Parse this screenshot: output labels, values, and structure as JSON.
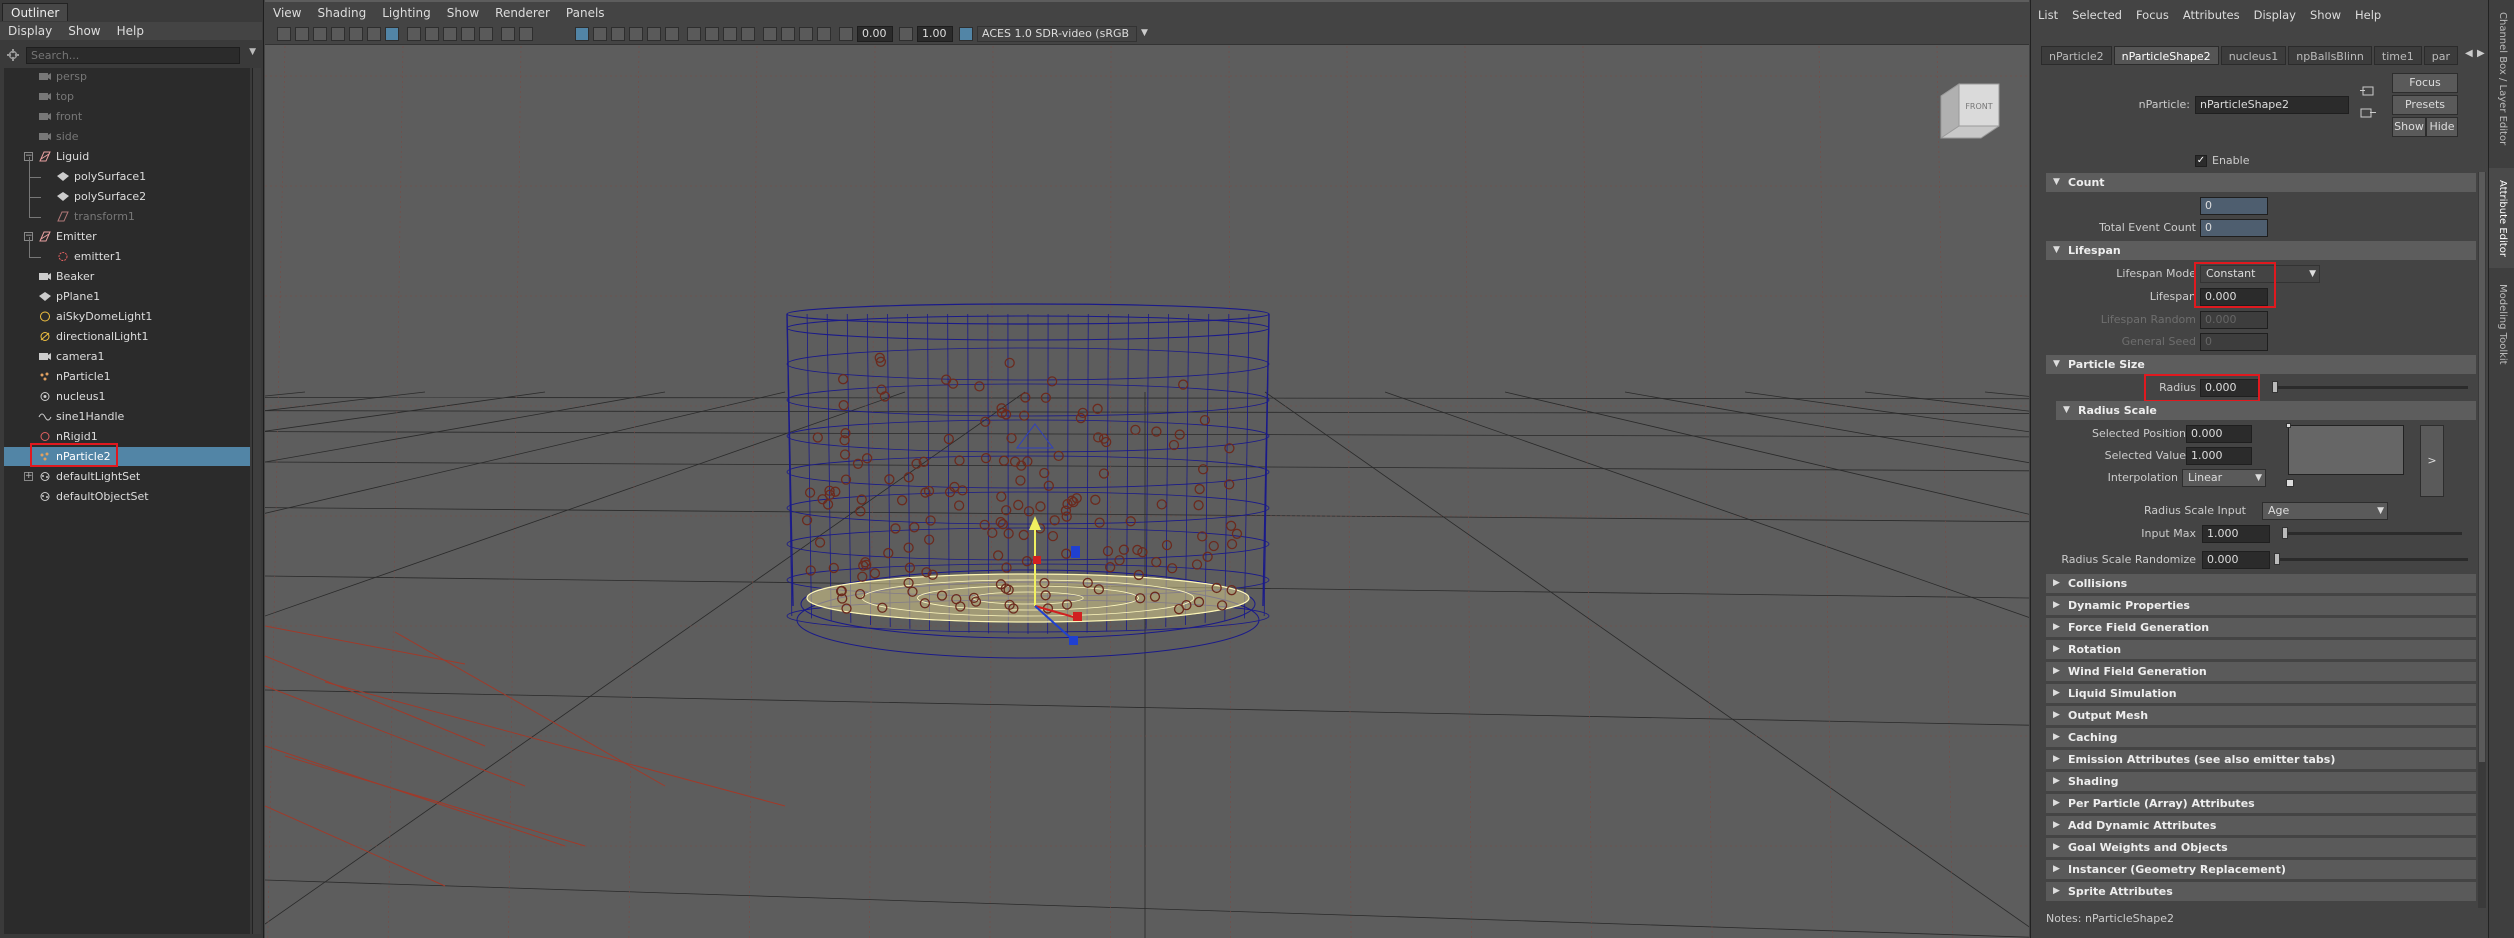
{
  "outliner": {
    "tab_label": "Outliner",
    "menu": [
      "Display",
      "Show",
      "Help"
    ],
    "search_placeholder": "Search...",
    "items": [
      {
        "label": "persp",
        "icon": "camera-icon",
        "dim": true
      },
      {
        "label": "top",
        "icon": "camera-icon",
        "dim": true
      },
      {
        "label": "front",
        "icon": "camera-icon",
        "dim": true
      },
      {
        "label": "side",
        "icon": "camera-icon",
        "dim": true
      },
      {
        "label": "Liguid",
        "icon": "group-icon"
      },
      {
        "label": "polySurface1",
        "icon": "mesh-icon"
      },
      {
        "label": "polySurface2",
        "icon": "mesh-icon"
      },
      {
        "label": "transform1",
        "icon": "transform-icon",
        "dim": true
      },
      {
        "label": "Emitter",
        "icon": "group-icon"
      },
      {
        "label": "emitter1",
        "icon": "emitter-icon"
      },
      {
        "label": "Beaker",
        "icon": "camera-icon"
      },
      {
        "label": "pPlane1",
        "icon": "mesh-icon"
      },
      {
        "label": "aiSkyDomeLight1",
        "icon": "skydome-light-icon"
      },
      {
        "label": "directionalLight1",
        "icon": "directional-light-icon"
      },
      {
        "label": "camera1",
        "icon": "camera-icon"
      },
      {
        "label": "nParticle1",
        "icon": "nparticle-icon"
      },
      {
        "label": "nucleus1",
        "icon": "nucleus-icon"
      },
      {
        "label": "sine1Handle",
        "icon": "deformer-handle-icon"
      },
      {
        "label": "nRigid1",
        "icon": "nrigid-icon"
      },
      {
        "label": "nParticle2",
        "icon": "nparticle-icon",
        "selected": true
      },
      {
        "label": "defaultLightSet",
        "icon": "set-icon"
      },
      {
        "label": "defaultObjectSet",
        "icon": "set-icon"
      }
    ]
  },
  "viewport": {
    "menu": [
      "View",
      "Shading",
      "Lighting",
      "Show",
      "Renderer",
      "Panels"
    ],
    "exposure": "0.00",
    "gamma": "1.00",
    "color_space": "ACES 1.0 SDR-video (sRGB",
    "viewcube_label": "FRONT"
  },
  "attribute_editor": {
    "menu": [
      "List",
      "Selected",
      "Focus",
      "Attributes",
      "Display",
      "Show",
      "Help"
    ],
    "tabs": [
      "nParticle2",
      "nParticleShape2",
      "nucleus1",
      "npBallsBlinn",
      "time1",
      "par"
    ],
    "active_tab": "nParticleShape2",
    "node_label": "nParticle:",
    "node_name": "nParticleShape2",
    "buttons": {
      "focus": "Focus",
      "presets": "Presets",
      "show": "Show",
      "hide": "Hide"
    },
    "enable_label": "Enable",
    "sections": {
      "count": "Count",
      "lifespan": "Lifespan",
      "particle_size": "Particle Size",
      "radius_scale": "Radius Scale"
    },
    "count": {
      "count_label": "Count",
      "count_value": "0",
      "total_label": "Total Event Count",
      "total_value": "0"
    },
    "lifespan": {
      "mode_label": "Lifespan Mode",
      "mode_value": "Constant",
      "lifespan_label": "Lifespan",
      "lifespan_value": "0.000",
      "random_label": "Lifespan Random",
      "random_value": "0.000",
      "seed_label": "General Seed",
      "seed_value": "0"
    },
    "particle_size": {
      "radius_label": "Radius",
      "radius_value": "0.000"
    },
    "radius_scale": {
      "sel_pos_label": "Selected Position",
      "sel_pos_value": "0.000",
      "sel_val_label": "Selected Value",
      "sel_val_value": "1.000",
      "interp_label": "Interpolation",
      "interp_value": "Linear",
      "input_label": "Radius Scale Input",
      "input_value": "Age",
      "input_max_label": "Input Max",
      "input_max_value": "1.000",
      "randomize_label": "Radius Scale Randomize",
      "randomize_value": "0.000",
      "expand_label": ">"
    },
    "collapsed_sections": [
      "Collisions",
      "Dynamic Properties",
      "Force Field Generation",
      "Rotation",
      "Wind Field Generation",
      "Liquid Simulation",
      "Output Mesh",
      "Caching",
      "Emission Attributes (see also emitter tabs)",
      "Shading",
      "Per Particle (Array) Attributes",
      "Add Dynamic Attributes",
      "Goal Weights and Objects",
      "Instancer (Geometry Replacement)",
      "Sprite Attributes"
    ],
    "notes": "Notes:  nParticleShape2"
  },
  "side_tabs": [
    "Channel Box / Layer Editor",
    "Attribute Editor",
    "Modeling Toolkit"
  ],
  "colors": {
    "selection": "#5285a6",
    "highlight_box": "#e0191f",
    "wireframe": "#1a1a8a",
    "grid_red": "#a03a2a"
  }
}
